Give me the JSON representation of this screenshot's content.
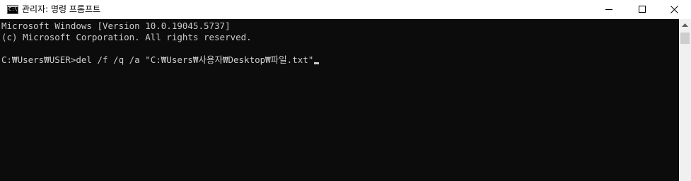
{
  "window": {
    "title": "관리자: 명령 프롬프트",
    "icon": "cmd-icon",
    "icon_text": "C:\\",
    "controls": {
      "minimize": "minimize-icon",
      "maximize": "maximize-icon",
      "close": "close-icon"
    }
  },
  "console": {
    "background": "#0c0c0c",
    "foreground": "#cccccc",
    "lines": [
      "Microsoft Windows [Version 10.0.19045.5737]",
      "(c) Microsoft Corporation. All rights reserved.",
      "",
      "C:₩Users₩USER>del /f /q /a \"C:₩Users₩사용자₩Desktop₩파일.txt\""
    ]
  },
  "scrollbar": {
    "up_arrow": "chevron-up-icon"
  }
}
